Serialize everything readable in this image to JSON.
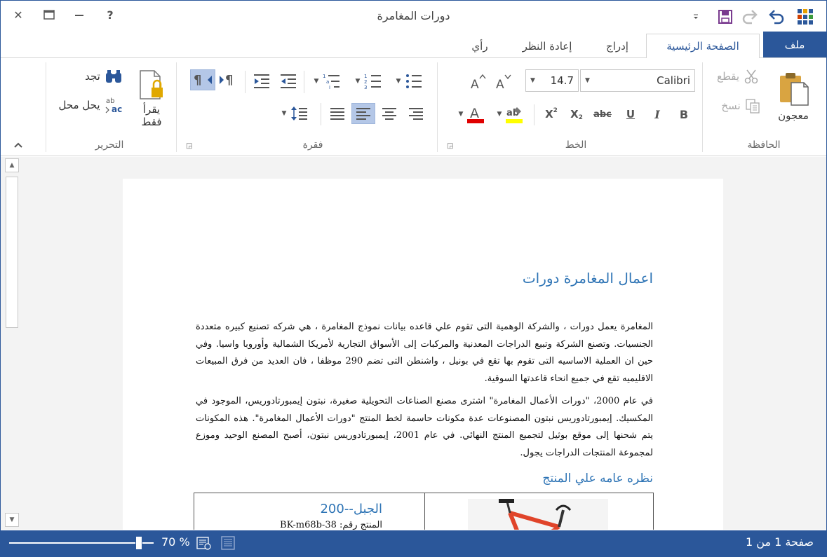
{
  "window": {
    "title": "دورات المغامرة",
    "close_glyph": "✕",
    "restore_glyph": "▭",
    "minimize_glyph": "—",
    "help_glyph": "?"
  },
  "tabs": [
    {
      "label": "ملف",
      "active": false,
      "file": true
    },
    {
      "label": "الصفحة الرئيسية",
      "active": true
    },
    {
      "label": "إدراج",
      "active": false
    },
    {
      "label": "إعادة النظر",
      "active": false
    },
    {
      "label": "رأي",
      "active": false
    }
  ],
  "ribbon": {
    "clipboard": {
      "label": "الحافظة",
      "paste": "معجون",
      "cut": "يقطع",
      "copy": "نسخ"
    },
    "font": {
      "label": "الخط",
      "font_name": "Calibri",
      "font_size": "14.7",
      "bold": "B",
      "italic": "I",
      "underline": "U",
      "strike": "abc",
      "subscript": "X",
      "superscript": "X",
      "highlight_color": "#ffff00",
      "font_color": "#e00000"
    },
    "paragraph": {
      "label": "فقرة"
    },
    "editing": {
      "label": "التحرير",
      "find": "تجد",
      "replace": "يحل محل",
      "read_only_line1": "يقرأ",
      "read_only_line2": "فقط"
    }
  },
  "document": {
    "heading": "اعمال المغامرة دورات",
    "paragraph1": "المغامرة يعمل دورات ، والشركة الوهمية التى تقوم علي قاعده بيانات نموذج المغامرة ، هي شركه تصنيع كبيره متعددة الجنسيات. وتصنع الشركة وتبيع الدراجات المعدنية والمركبات إلى الأسواق التجارية لأمريكا الشمالية وأوروبا واسيا. وفي حين ان العملية الاساسيه التى تقوم بها تقع في بونيل ، واشنطن التى تضم 290 موظفا ، فان العديد من فرق المبيعات الاقليميه تقع في جميع انحاء قاعدتها السوقية.",
    "paragraph2": "في عام 2000، \"دورات الأعمال المغامرة\" اشترى مصنع الصناعات التحويلية صغيرة، نبتون إيمبورتادوريس، الموجود في المكسيك. إيمبورتادوريس نبتون المصنوعات عدة مكونات حاسمة لخط المنتج \"دورات الأعمال المغامرة\". هذه المكونات يتم شحنها إلى موقع بوثيل لتجميع المنتج النهائي. في عام 2001، إيمبورتادوريس نبتون، أصبح المصنع الوحيد وموزع لمجموعة المنتجات الدراجات يجول.",
    "subheading": "نظره عامه علي المنتج",
    "product_name": "الجبل--200",
    "product_number": "المنتج رقم: BK-m68b-38"
  },
  "status": {
    "page": "صفحة 1 من 1",
    "zoom": "70 %",
    "zoom_level_percent": 70
  },
  "colors": {
    "accent": "#2b579a",
    "heading": "#2e74b5"
  }
}
